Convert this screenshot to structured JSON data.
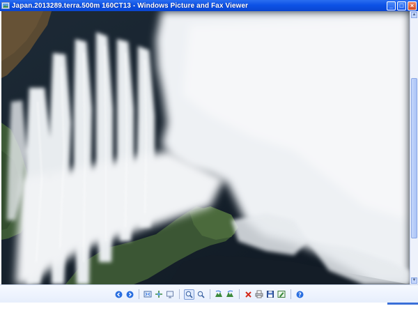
{
  "window": {
    "title": "Japan.2013289.terra.500m 160CT13 - Windows Picture and Fax Viewer",
    "buttons": {
      "minimize": "_",
      "maximize": "□",
      "close": "×"
    }
  },
  "toolbar": {
    "items": [
      "previous-image",
      "next-image",
      "best-fit",
      "actual-size",
      "slideshow",
      "zoom-in",
      "zoom-out",
      "rotate-clockwise",
      "rotate-counterclockwise",
      "delete",
      "print",
      "copy-to",
      "edit",
      "help"
    ]
  },
  "colors": {
    "titlebar": "#0d52e6",
    "ocean": "#1a2530",
    "cloud": "#f4f6f8",
    "land": "#3c5a34"
  }
}
